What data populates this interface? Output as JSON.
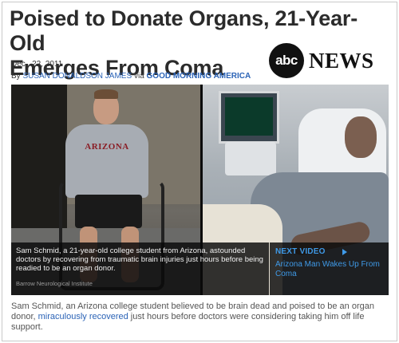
{
  "article": {
    "headline_line1": "Poised to Donate Organs, 21-Year-Old",
    "headline_line2": "Emerges From Coma",
    "date": "Dec., 22, 2011",
    "byline_prefix": "By",
    "author": "Susan Donaldson James",
    "via": "via",
    "outlet": "Good Morning America"
  },
  "logo": {
    "abc": "abc",
    "news": "NEWS"
  },
  "media": {
    "left_photo_shirt_text": "ARIZONA",
    "caption": "Sam Schmid, a 21-year-old college student from Arizona, astounded doctors by recovering from traumatic brain injuries just hours before being readied to be an organ donor.",
    "credit": "Barrow Neurological Institute",
    "next_video_label": "Next Video",
    "next_video_title": "Arizona Man Wakes Up From Coma"
  },
  "body": {
    "text_before_link": "Sam Schmid, an Arizona college student believed to be brain dead and poised to be an organ donor, ",
    "link_text": "miraculously recovered",
    "text_after_link": " just hours before doctors were considering taking him off life support."
  },
  "colors": {
    "link_blue": "#2b63b6",
    "next_video_blue": "#3f9ae8",
    "headline": "#2b2b2b"
  },
  "icons": {
    "next_arrow": "play-arrow-icon"
  }
}
